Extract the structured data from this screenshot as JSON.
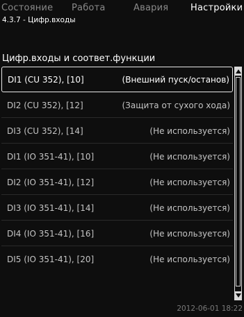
{
  "tabs": [
    {
      "label": "Состояние",
      "active": false
    },
    {
      "label": "Работа",
      "active": false
    },
    {
      "label": "Авария",
      "active": false
    },
    {
      "label": "Настройки",
      "active": true
    }
  ],
  "breadcrumb": "4.3.7 - Цифр.входы",
  "section_title": "Цифр.входы и соответ.функции",
  "rows": [
    {
      "name": "DI1 (CU 352), [10]",
      "value": "(Внешний пуск/останов)",
      "selected": true
    },
    {
      "name": "DI2 (CU 352), [12]",
      "value": "(Защита от сухого хода)",
      "selected": false
    },
    {
      "name": "DI3 (CU 352), [14]",
      "value": "(Не используется)",
      "selected": false
    },
    {
      "name": "DI1 (IO 351-41), [10]",
      "value": "(Не используется)",
      "selected": false
    },
    {
      "name": "DI2 (IO 351-41), [12]",
      "value": "(Не используется)",
      "selected": false
    },
    {
      "name": "DI3 (IO 351-41), [14]",
      "value": "(Не используется)",
      "selected": false
    },
    {
      "name": "DI4 (IO 351-41), [16]",
      "value": "(Не используется)",
      "selected": false
    },
    {
      "name": "DI5 (IO 351-41), [20]",
      "value": "(Не используется)",
      "selected": false
    }
  ],
  "footer": {
    "datetime": "2012-06-01 18:22"
  },
  "icons": {
    "scroll_up": "scroll-up-arrow-icon",
    "scroll_down": "scroll-down-arrow-icon"
  },
  "colors": {
    "background": "#0e0e0e",
    "text": "#ffffff",
    "inactive_tab": "#8a8a8a",
    "selection_border": "#e8e8e8"
  }
}
